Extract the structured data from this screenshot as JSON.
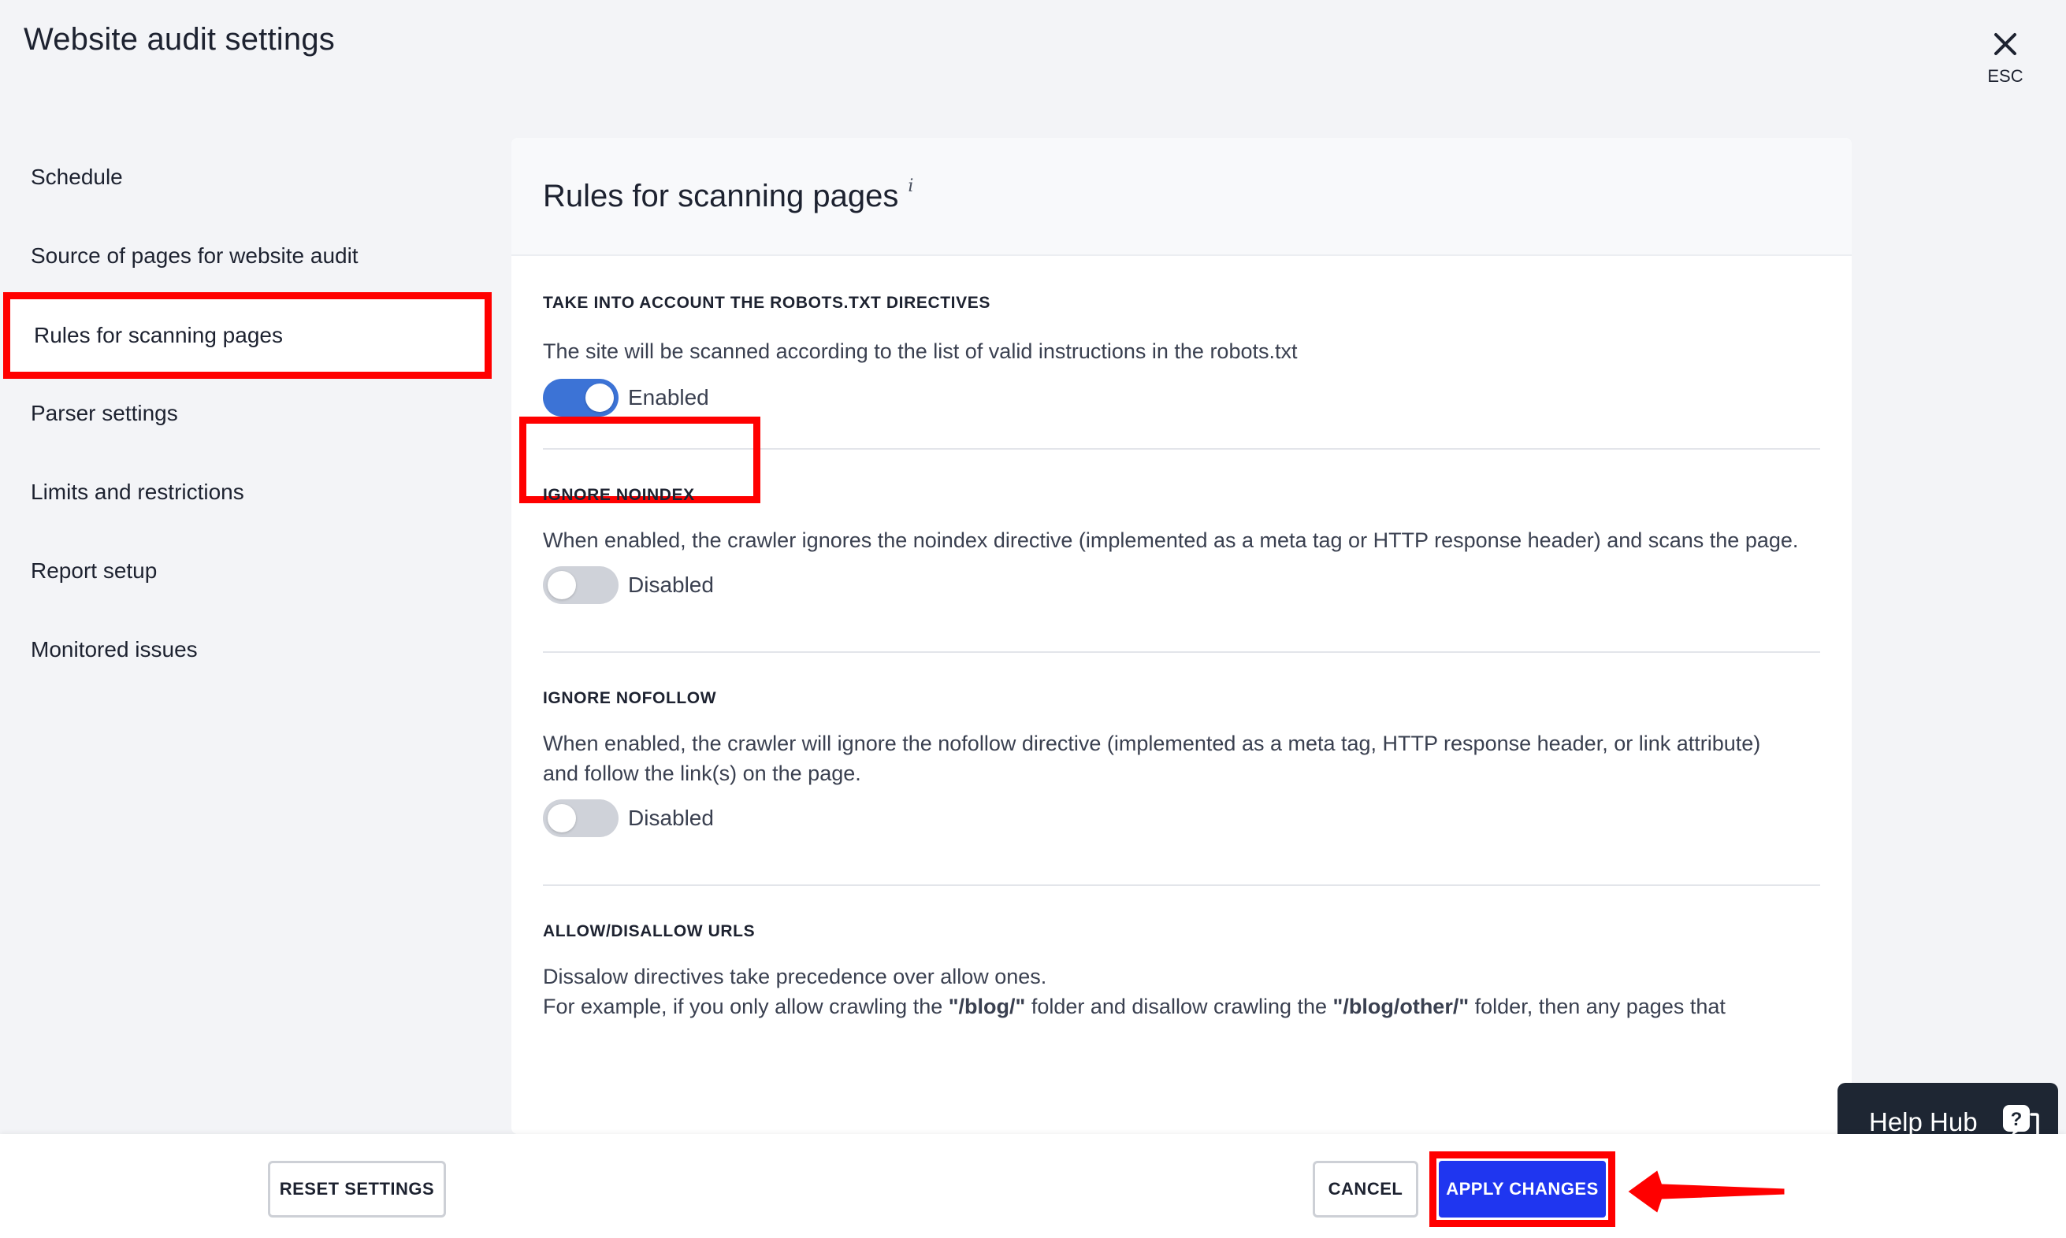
{
  "window": {
    "title": "Website audit settings",
    "close_label": "ESC"
  },
  "sidebar": {
    "items": [
      {
        "label": "Schedule"
      },
      {
        "label": "Source of pages for website audit"
      },
      {
        "label": "Rules for scanning pages",
        "active": true
      },
      {
        "label": "Parser settings"
      },
      {
        "label": "Limits and restrictions"
      },
      {
        "label": "Report setup"
      },
      {
        "label": "Monitored issues"
      }
    ]
  },
  "panel": {
    "title": "Rules for scanning pages",
    "info_icon": "i",
    "sections": [
      {
        "label": "TAKE INTO ACCOUNT THE ROBOTS.TXT DIRECTIVES",
        "description": "The site will be scanned according to the list of valid instructions in the robots.txt",
        "toggle_state": "Enabled",
        "enabled": true
      },
      {
        "label": "IGNORE NOINDEX",
        "description": "When enabled, the crawler ignores the noindex directive (implemented as a meta tag or HTTP response header) and scans the page.",
        "toggle_state": "Disabled",
        "enabled": false
      },
      {
        "label": "IGNORE NOFOLLOW",
        "description": "When enabled, the crawler will ignore the nofollow directive (implemented as a meta tag, HTTP response header, or link attribute) and follow the link(s) on the page.",
        "toggle_state": "Disabled",
        "enabled": false
      },
      {
        "label": "ALLOW/DISALLOW URLS",
        "description_line1": "Dissalow directives take precedence over allow ones.",
        "description_line2_a": "For example, if you only allow crawling the ",
        "description_line2_b": "\"/blog/\"",
        "description_line2_c": " folder and disallow crawling the ",
        "description_line2_d": "\"/blog/other/\"",
        "description_line2_e": " folder, then any pages that"
      }
    ]
  },
  "footer": {
    "reset_label": "RESET SETTINGS",
    "cancel_label": "CANCEL",
    "apply_label": "APPLY CHANGES"
  },
  "help_hub": {
    "label": "Help Hub"
  },
  "colors": {
    "highlight": "#ff0000",
    "apply_button": "#1f36f0",
    "toggle_on": "#3c73d6",
    "toggle_off": "#cfd2d9",
    "help_hub_bg": "#1e2633"
  }
}
